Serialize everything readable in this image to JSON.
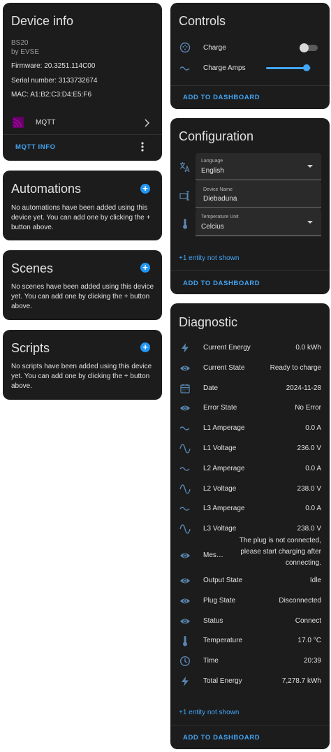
{
  "device_info": {
    "title": "Device info",
    "model": "BS20",
    "manufacturer": "by EVSE",
    "firmware": "Firmware: 20.3251.114C00",
    "serial": "Serial number: 3133732674",
    "mac": "MAC: A1:B2:C3:D4:E5:F6",
    "integration": "MQTT",
    "action": "MQTT INFO"
  },
  "automations": {
    "title": "Automations",
    "text": "No automations have been added using this device yet. You can add one by clicking the + button above."
  },
  "scenes": {
    "title": "Scenes",
    "text": "No scenes have been added using this device yet. You can add one by clicking the + button above."
  },
  "scripts": {
    "title": "Scripts",
    "text": "No scripts have been added using this device yet. You can add one by clicking the + button above."
  },
  "controls": {
    "title": "Controls",
    "charge_label": "Charge",
    "charge_on": false,
    "amps_label": "Charge Amps",
    "amps_level": 0.9,
    "add": "ADD TO DASHBOARD"
  },
  "configuration": {
    "title": "Configuration",
    "language_label": "Language",
    "language_value": "English",
    "device_name_label": "Device Name",
    "device_name_value": "Diebaduna",
    "temp_unit_label": "Temperature Unit",
    "temp_unit_value": "Celcius",
    "hidden": "+1 entity not shown",
    "add": "ADD TO DASHBOARD"
  },
  "diagnostic": {
    "title": "Diagnostic",
    "rows": [
      {
        "icon": "flash-icon",
        "label": "Current Energy",
        "value": "0.0 kWh"
      },
      {
        "icon": "eye-icon",
        "label": "Current State",
        "value": "Ready to charge"
      },
      {
        "icon": "calendar-icon",
        "label": "Date",
        "value": "2024-11-28"
      },
      {
        "icon": "eye-icon",
        "label": "Error State",
        "value": "No Error"
      },
      {
        "icon": "current-ac-icon",
        "label": "L1 Amperage",
        "value": "0.0 A"
      },
      {
        "icon": "sine-wave-icon",
        "label": "L1 Voltage",
        "value": "236.0 V"
      },
      {
        "icon": "current-ac-icon",
        "label": "L2 Amperage",
        "value": "0.0 A"
      },
      {
        "icon": "sine-wave-icon",
        "label": "L2 Voltage",
        "value": "238.0 V"
      },
      {
        "icon": "current-ac-icon",
        "label": "L3 Amperage",
        "value": "0.0 A"
      },
      {
        "icon": "sine-wave-icon",
        "label": "L3 Voltage",
        "value": "238.0 V"
      }
    ],
    "message_label": "Mes…",
    "message_lines": [
      "The plug is not connected,",
      "please start charging after",
      "connecting."
    ],
    "rows2": [
      {
        "icon": "eye-icon",
        "label": "Output State",
        "value": "Idle"
      },
      {
        "icon": "eye-icon",
        "label": "Plug State",
        "value": "Disconnected"
      },
      {
        "icon": "eye-icon",
        "label": "Status",
        "value": "Connect"
      },
      {
        "icon": "thermometer-icon",
        "label": "Temperature",
        "value": "17.0 °C"
      },
      {
        "icon": "clock-icon",
        "label": "Time",
        "value": "20:39"
      },
      {
        "icon": "flash-icon",
        "label": "Total Energy",
        "value": "7,278.7 kWh"
      }
    ],
    "hidden": "+1 entity not shown",
    "add": "ADD TO DASHBOARD"
  },
  "colors": {
    "accent": "#42a5f5",
    "card": "#1c1c1c",
    "icon": "#5a87b0",
    "mqtt": "#660066"
  }
}
